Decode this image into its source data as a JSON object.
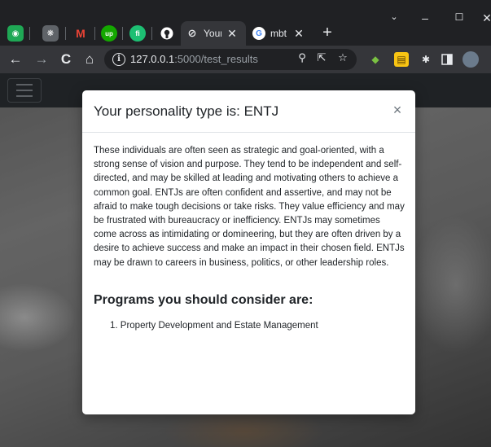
{
  "browser": {
    "pinned_tabs": [
      {
        "icon": "whatsapp-icon",
        "glyph": "◉",
        "color": "#25d366"
      },
      {
        "icon": "chatgpt-icon",
        "glyph": "❋",
        "color": "#10a37f"
      },
      {
        "icon": "gmail-icon",
        "glyph": "M",
        "color": "#ea4335"
      },
      {
        "icon": "upwork-icon",
        "glyph": "up",
        "color": "#14a800"
      },
      {
        "icon": "fiverr-icon",
        "glyph": "fi",
        "color": "#1dbf73"
      },
      {
        "icon": "github-icon",
        "glyph": "●",
        "color": "#ffffff"
      }
    ],
    "tabs": [
      {
        "title": "Your",
        "icon": "globe-icon",
        "active": true
      },
      {
        "title": "mbt",
        "icon": "google-icon",
        "active": false
      }
    ],
    "url_host": "127.0.0.1",
    "url_path": ":5000/test_results"
  },
  "modal": {
    "title": "Your personality type is: ENTJ",
    "close_glyph": "×",
    "description": "These individuals are often seen as strategic and goal-oriented, with a strong sense of vision and purpose. They tend to be independent and self-directed, and may be skilled at leading and motivating others to achieve a common goal. ENTJs are often confident and assertive, and may not be afraid to make tough decisions or take risks. They value efficiency and may be frustrated with bureaucracy or inefficiency. ENTJs may sometimes come across as intimidating or domineering, but they are often driven by a desire to achieve success and make an impact in their chosen field. ENTJs may be drawn to careers in business, politics, or other leadership roles.",
    "programs_heading": "Programs you should consider are:",
    "programs": [
      "1. Property Development and Estate Management"
    ]
  }
}
